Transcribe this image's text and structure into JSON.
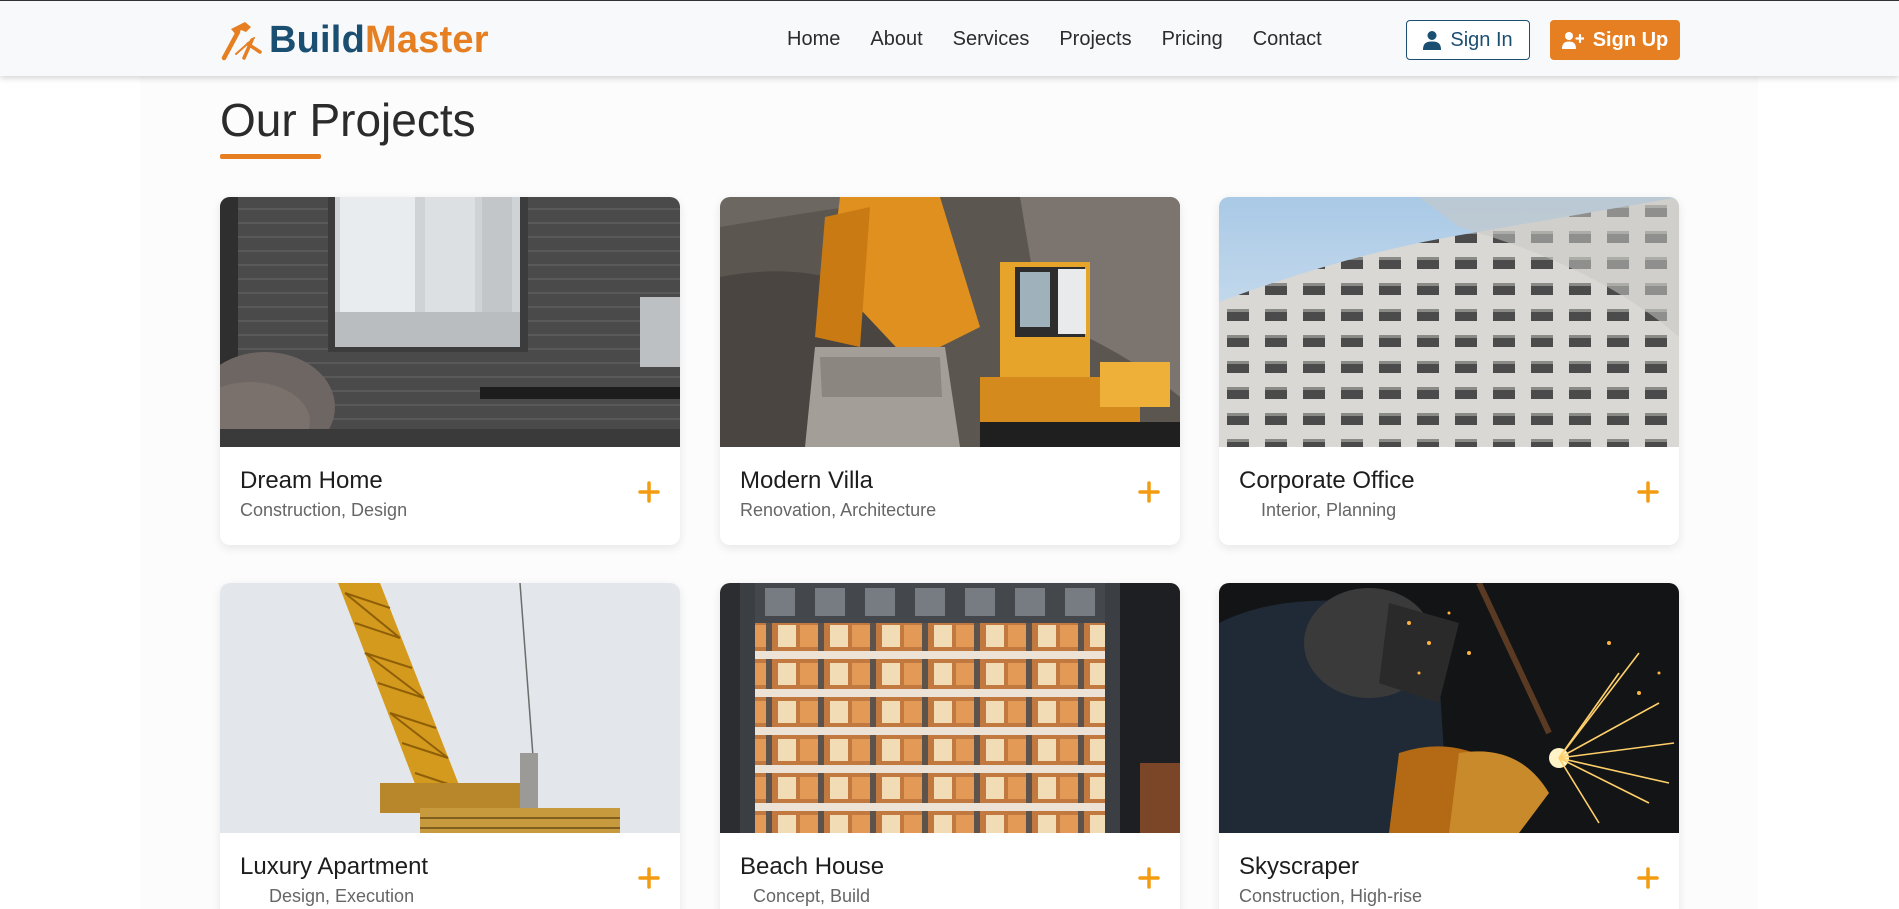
{
  "brand": {
    "part1": "Build",
    "part2": "Master",
    "icon": "hammer-logo-icon"
  },
  "nav": {
    "links": [
      {
        "label": "Home"
      },
      {
        "label": "About"
      },
      {
        "label": "Services"
      },
      {
        "label": "Projects"
      },
      {
        "label": "Pricing"
      },
      {
        "label": "Contact"
      }
    ],
    "sign_in": {
      "label": "Sign In",
      "icon": "user-icon"
    },
    "sign_up": {
      "label": "Sign Up",
      "icon": "user-plus-icon"
    }
  },
  "projects": {
    "title": "Our Projects",
    "cards": [
      {
        "title": "Dream Home",
        "subtitle": "Construction, Design",
        "image": "dark-brick-house-photo"
      },
      {
        "title": "Modern Villa",
        "subtitle": "Renovation, Architecture",
        "image": "yellow-excavator-photo"
      },
      {
        "title": "Corporate Office",
        "subtitle": "Interior, Planning",
        "image": "office-tower-windows-photo"
      },
      {
        "title": "Luxury Apartment",
        "subtitle": "Design, Execution",
        "image": "tower-crane-photo"
      },
      {
        "title": "Beach House",
        "subtitle": "Concept, Build",
        "image": "lit-building-frame-photo"
      },
      {
        "title": "Skyscraper",
        "subtitle": "Construction, High-rise",
        "image": "welder-sparks-photo"
      }
    ]
  },
  "colors": {
    "brand_dark": "#1b4f72",
    "accent": "#e67e22",
    "nav_bg": "#f8f9fa"
  }
}
